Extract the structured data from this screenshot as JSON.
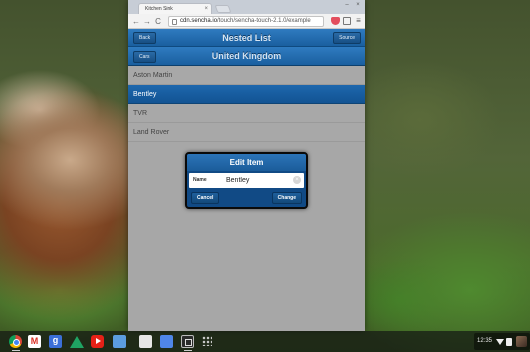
{
  "browser": {
    "tab_title": "Kitchen Sink",
    "tab_close": "×",
    "window_minimize": "–",
    "window_close": "×",
    "nav_back": "←",
    "nav_forward": "→",
    "reload": "C",
    "url_host": "cdn.sencha.io",
    "url_path": "/touch/sencha-touch-2.1.0/example",
    "menu": "≡"
  },
  "app": {
    "title": "Nested List",
    "back_label": "Back",
    "source_label": "Source",
    "subtitle": "United Kingdom",
    "cars_label": "Cars",
    "list_items": [
      "Aston Martin",
      "Bentley",
      "TVR",
      "Land Rover"
    ],
    "selected_item": "Bentley"
  },
  "modal": {
    "title": "Edit Item",
    "field_label": "Name",
    "field_value": "Bentley",
    "clear_icon": "×",
    "cancel_label": "Cancel",
    "change_label": "Change"
  },
  "shelf": {
    "clock": "12:35",
    "icons": [
      "chrome-icon",
      "gmail-icon",
      "google-plus-icon",
      "drive-icon",
      "youtube-icon",
      "web-store-icon",
      "files-icon",
      "files-icon",
      "window-icon",
      "app-launcher-icon"
    ]
  }
}
